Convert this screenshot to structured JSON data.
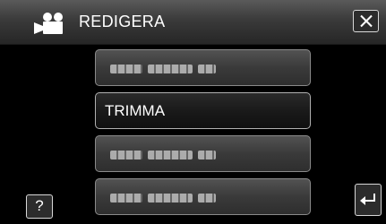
{
  "header": {
    "title": "REDIGERA",
    "title_icon": "video-camera-icon",
    "close_icon": "close-icon"
  },
  "menu": {
    "items": [
      {
        "label": "",
        "obscured": true,
        "active": false
      },
      {
        "label": "TRIMMA",
        "obscured": false,
        "active": true
      },
      {
        "label": "",
        "obscured": true,
        "active": false
      },
      {
        "label": "",
        "obscured": true,
        "active": false
      }
    ]
  },
  "footer": {
    "help_label": "?",
    "back_icon": "return-arrow-icon"
  },
  "colors": {
    "background": "#000000",
    "header": "#3a3a3a",
    "button_border": "#d8d8d8",
    "text": "#ffffff"
  }
}
